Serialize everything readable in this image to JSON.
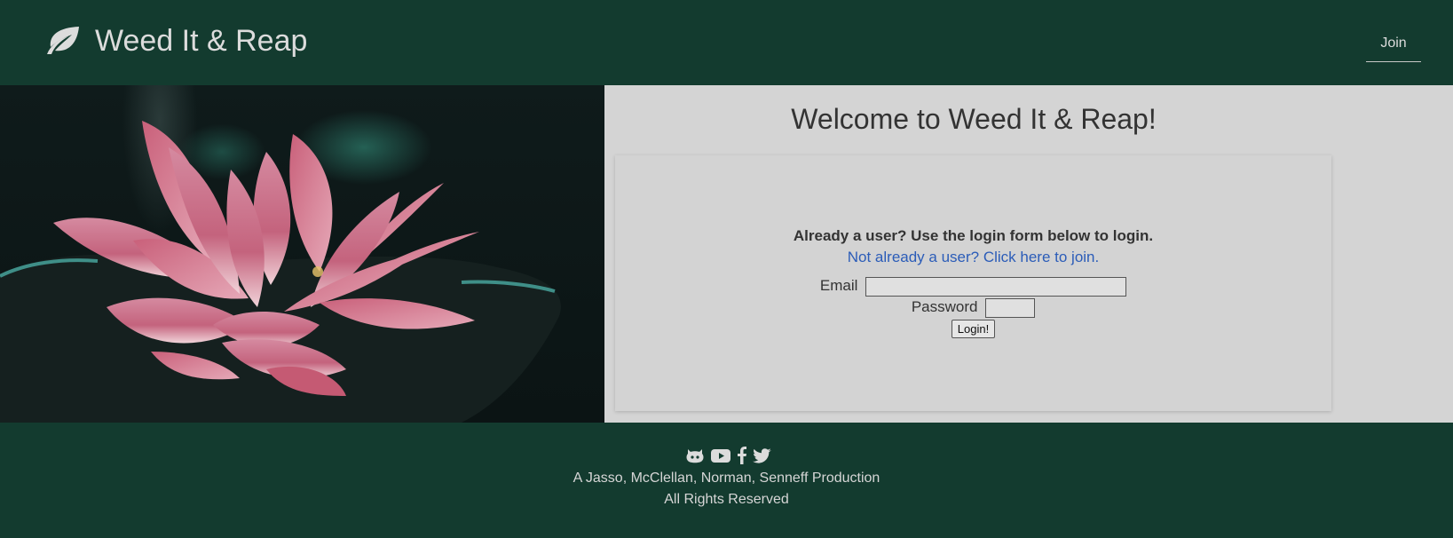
{
  "header": {
    "brand": "Weed It & Reap",
    "nav_join": "Join"
  },
  "main": {
    "welcome_title": "Welcome to Weed It & Reap!",
    "prompt": "Already a user? Use the login form below to login.",
    "join_link": "Not already a user? Click here to join.",
    "email_label": "Email",
    "password_label": "Password",
    "email_value": "",
    "password_value": "",
    "login_button": "Login!"
  },
  "footer": {
    "social_icons": [
      "github-icon",
      "youtube-icon",
      "facebook-icon",
      "twitter-icon"
    ],
    "credit": "A Jasso, McClellan, Norman, Senneff Production",
    "rights": "All Rights Reserved"
  },
  "colors": {
    "header_bg": "#133b2f",
    "page_bg": "#d4d4d4",
    "link": "#2b5cb8"
  }
}
